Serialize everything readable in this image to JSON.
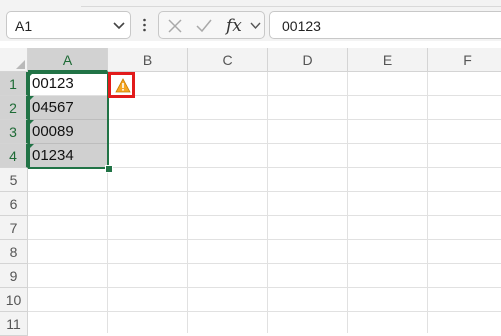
{
  "name_box": {
    "value": "A1"
  },
  "formula_bar": {
    "value": "00123"
  },
  "columns": [
    "A",
    "B",
    "C",
    "D",
    "E",
    "F"
  ],
  "rows": [
    "1",
    "2",
    "3",
    "4",
    "5",
    "6",
    "7",
    "8",
    "9",
    "10",
    "11"
  ],
  "cells": {
    "A1": "00123",
    "A2": "04567",
    "A3": "00089",
    "A4": "01234"
  },
  "icons": {
    "namebox_dropdown": "chevron-down-icon",
    "more": "vertical-ellipsis-icon",
    "cancel": "close-icon",
    "enter": "checkmark-icon",
    "function": "fx-icon",
    "fx_dropdown": "chevron-down-icon",
    "error_indicator": "warning-triangle-icon"
  },
  "colors": {
    "selection": "#217346",
    "highlight_box": "#e21b1b",
    "warning": "#f5a623"
  }
}
